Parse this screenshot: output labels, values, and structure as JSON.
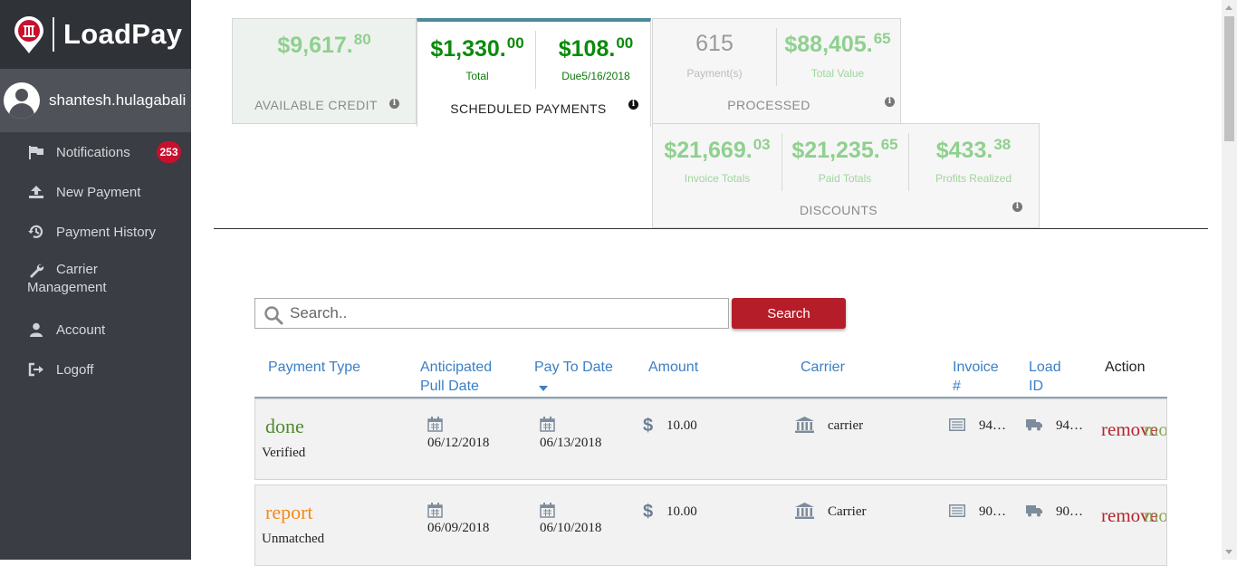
{
  "app": {
    "brand": "LoadPay",
    "username": "shantesh.hulagabali"
  },
  "sidebar": {
    "items": [
      {
        "label": "Notifications",
        "icon": "flag-icon",
        "badge": "253"
      },
      {
        "label": "New Payment",
        "icon": "upload-icon"
      },
      {
        "label": "Payment History",
        "icon": "history-icon"
      },
      {
        "label": "Carrier Management",
        "icon": "wrench-icon"
      },
      {
        "label": "Account",
        "icon": "user-icon"
      },
      {
        "label": "Logoff",
        "icon": "logout-icon"
      }
    ]
  },
  "cards": {
    "credit": {
      "amount": "$9,617.",
      "cents": "80",
      "caption": "AVAILABLE CREDIT"
    },
    "scheduled": {
      "total_amount": "$1,330.",
      "total_cents": "00",
      "total_label": "Total",
      "due_amount": "$108.",
      "due_cents": "00",
      "due_label": "Due5/16/2018",
      "caption": "SCHEDULED PAYMENTS"
    },
    "processed": {
      "count": "615",
      "count_label": "Payment(s)",
      "value_amount": "$88,405.",
      "value_cents": "65",
      "value_label": "Total Value",
      "caption": "PROCESSED"
    },
    "discounts": {
      "invoice_amount": "$21,669.",
      "invoice_cents": "03",
      "invoice_label": "Invoice Totals",
      "paid_amount": "$21,235.",
      "paid_cents": "65",
      "paid_label": "Paid Totals",
      "profit_amount": "$433.",
      "profit_cents": "38",
      "profit_label": "Profits Realized",
      "caption": "DISCOUNTS"
    }
  },
  "search": {
    "placeholder": "Search..",
    "value": "",
    "button_label": "Search"
  },
  "table": {
    "headers": {
      "payment_type": "Payment Type",
      "pull_date_1": "Anticipated",
      "pull_date_2": "Pull Date",
      "pay_to_date": "Pay To Date",
      "amount": "Amount",
      "carrier": "Carrier",
      "invoice_1": "Invoice",
      "invoice_2": "#",
      "load_1": "Load",
      "load_2": "ID",
      "action": "Action"
    },
    "rows": [
      {
        "status": "done",
        "status_color": "#4e8a2e",
        "sub_status": "Verified",
        "pull_date": "06/12/2018",
        "pay_date": "06/13/2018",
        "amount": "10.00",
        "carrier": "carrier",
        "invoice": "94…",
        "load_id": "94…",
        "action_remove": "remove",
        "action_overlay": "mode_bir"
      },
      {
        "status": "report",
        "status_color": "#f08a1c",
        "sub_status": "Unmatched",
        "pull_date": "06/09/2018",
        "pay_date": "06/10/2018",
        "amount": "10.00",
        "carrier": "Carrier",
        "invoice": "90…",
        "load_id": "90…",
        "action_remove": "remove",
        "action_overlay": "mode_bir"
      }
    ]
  }
}
